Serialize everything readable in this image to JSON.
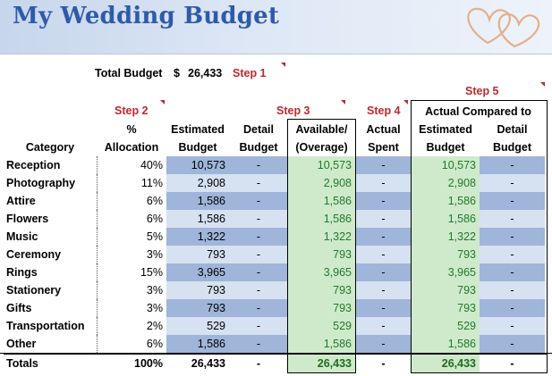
{
  "title": "My Wedding Budget",
  "total_budget": {
    "label": "Total Budget",
    "currency": "$",
    "value": "26,433",
    "step": "Step 1"
  },
  "steps": {
    "step2": "Step 2",
    "step3": "Step 3",
    "step4": "Step 4",
    "step5": "Step 5"
  },
  "headers": {
    "category": "Category",
    "alloc_line1": "%",
    "alloc_line2": "Allocation",
    "est_line1": "Estimated",
    "est_line2": "Budget",
    "det_line1": "Detail",
    "det_line2": "Budget",
    "avail_line1": "Available/",
    "avail_line2": "(Overage)",
    "act_line1": "Actual",
    "act_line2": "Spent",
    "compared": "Actual Compared to",
    "ce_line1": "Estimated",
    "ce_line2": "Budget",
    "cd_line1": "Detail",
    "cd_line2": "Budget"
  },
  "rows": [
    {
      "category": "Reception",
      "alloc": "40%",
      "est": "10,573",
      "det": "-",
      "avail": "10,573",
      "act": "-",
      "ce": "10,573",
      "cd": "-"
    },
    {
      "category": "Photography",
      "alloc": "11%",
      "est": "2,908",
      "det": "-",
      "avail": "2,908",
      "act": "-",
      "ce": "2,908",
      "cd": "-"
    },
    {
      "category": "Attire",
      "alloc": "6%",
      "est": "1,586",
      "det": "-",
      "avail": "1,586",
      "act": "-",
      "ce": "1,586",
      "cd": "-"
    },
    {
      "category": "Flowers",
      "alloc": "6%",
      "est": "1,586",
      "det": "-",
      "avail": "1,586",
      "act": "-",
      "ce": "1,586",
      "cd": "-"
    },
    {
      "category": "Music",
      "alloc": "5%",
      "est": "1,322",
      "det": "-",
      "avail": "1,322",
      "act": "-",
      "ce": "1,322",
      "cd": "-"
    },
    {
      "category": "Ceremony",
      "alloc": "3%",
      "est": "793",
      "det": "-",
      "avail": "793",
      "act": "-",
      "ce": "793",
      "cd": "-"
    },
    {
      "category": "Rings",
      "alloc": "15%",
      "est": "3,965",
      "det": "-",
      "avail": "3,965",
      "act": "-",
      "ce": "3,965",
      "cd": "-"
    },
    {
      "category": "Stationery",
      "alloc": "3%",
      "est": "793",
      "det": "-",
      "avail": "793",
      "act": "-",
      "ce": "793",
      "cd": "-"
    },
    {
      "category": "Gifts",
      "alloc": "3%",
      "est": "793",
      "det": "-",
      "avail": "793",
      "act": "-",
      "ce": "793",
      "cd": "-"
    },
    {
      "category": "Transportation",
      "alloc": "2%",
      "est": "529",
      "det": "-",
      "avail": "529",
      "act": "-",
      "ce": "529",
      "cd": "-"
    },
    {
      "category": "Other",
      "alloc": "6%",
      "est": "1,586",
      "det": "-",
      "avail": "1,586",
      "act": "-",
      "ce": "1,586",
      "cd": "-"
    }
  ],
  "totals": {
    "category": "Totals",
    "alloc": "100%",
    "est": "26,433",
    "det": "-",
    "avail": "26,433",
    "act": "-",
    "ce": "26,433",
    "cd": "-"
  },
  "colors": {
    "title": "#2f5aa8",
    "step_red": "#c0272d",
    "band_dark": "#9fb5d9",
    "band_light": "#d6e1f1",
    "green_fill": "#cfeacb",
    "green_text": "#1e7a2a"
  },
  "icons": [
    "hearts-decoration"
  ]
}
